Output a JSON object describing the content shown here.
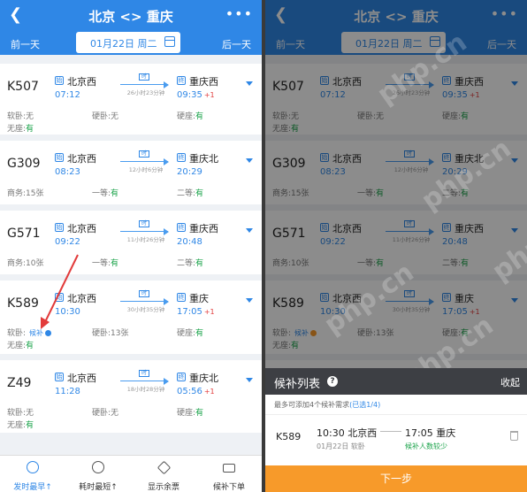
{
  "screen_left": {
    "header": {
      "back_icon": "back-arrow-icon",
      "title": "北京 <> 重庆",
      "more_icon": "more-dots-icon"
    },
    "date_bar": {
      "prev_label": "前一天",
      "date": "01月22日 周二",
      "next_label": "后一天"
    },
    "trains": [
      {
        "number": "K507",
        "from": "北京西",
        "from_tag": "始",
        "dep": "07:12",
        "duration": "26小时23分钟",
        "duration_tag": "时",
        "to": "重庆西",
        "to_tag": "终",
        "arr": "09:35",
        "day_plus": "+1",
        "row1": [
          {
            "label": "软卧:",
            "value": "无",
            "avail": false
          },
          {
            "label": "硬卧:",
            "value": "无",
            "avail": false
          },
          {
            "label": "硬座:",
            "value": "有",
            "avail": true
          }
        ],
        "row2": [
          {
            "label": "无座:",
            "value": "有",
            "avail": true
          }
        ]
      },
      {
        "number": "G309",
        "from": "北京西",
        "from_tag": "始",
        "dep": "08:23",
        "duration": "12小时6分钟",
        "duration_tag": "时",
        "to": "重庆北",
        "to_tag": "终",
        "arr": "20:29",
        "day_plus": "",
        "row1": [
          {
            "label": "商务:",
            "value": "15张",
            "avail": false
          },
          {
            "label": "一等:",
            "value": "有",
            "avail": true
          },
          {
            "label": "二等:",
            "value": "有",
            "avail": true
          }
        ],
        "row2": []
      },
      {
        "number": "G571",
        "from": "北京西",
        "from_tag": "始",
        "dep": "09:22",
        "duration": "11小时26分钟",
        "duration_tag": "时",
        "to": "重庆西",
        "to_tag": "终",
        "arr": "20:48",
        "day_plus": "",
        "row1": [
          {
            "label": "商务:",
            "value": "10张",
            "avail": false
          },
          {
            "label": "一等:",
            "value": "有",
            "avail": true
          },
          {
            "label": "二等:",
            "value": "有",
            "avail": true
          }
        ],
        "row2": []
      },
      {
        "number": "K589",
        "from": "北京西",
        "from_tag": "始",
        "dep": "10:30",
        "duration": "30小时35分钟",
        "duration_tag": "时",
        "to": "重庆",
        "to_tag": "终",
        "arr": "17:05",
        "day_plus": "+1",
        "row1": [
          {
            "label": "软卧:",
            "value": "",
            "avail": false,
            "houbu": "候补"
          },
          {
            "label": "硬卧:",
            "value": "13张",
            "avail": false
          },
          {
            "label": "硬座:",
            "value": "有",
            "avail": true
          }
        ],
        "row2": [
          {
            "label": "无座:",
            "value": "有",
            "avail": true
          }
        ]
      },
      {
        "number": "Z49",
        "from": "北京西",
        "from_tag": "始",
        "dep": "11:28",
        "duration": "18小时28分钟",
        "duration_tag": "时",
        "to": "重庆北",
        "to_tag": "终",
        "arr": "05:56",
        "day_plus": "+1",
        "row1": [
          {
            "label": "软卧:",
            "value": "无",
            "avail": false
          },
          {
            "label": "硬卧:",
            "value": "无",
            "avail": false
          },
          {
            "label": "硬座:",
            "value": "有",
            "avail": true
          }
        ],
        "row2": [
          {
            "label": "无座:",
            "value": "有",
            "avail": true
          }
        ]
      }
    ],
    "tabs": [
      {
        "label": "发时最早↑",
        "icon": "clock-24-icon",
        "active": true
      },
      {
        "label": "耗时最短↑",
        "icon": "timer-icon",
        "active": false
      },
      {
        "label": "显示余票",
        "icon": "ticket-tag-icon",
        "active": false
      },
      {
        "label": "候补下单",
        "icon": "cart-icon",
        "active": false
      }
    ]
  },
  "screen_right": {
    "header": {
      "title": "北京 <> 重庆"
    },
    "date_bar": {
      "prev_label": "前一天",
      "date": "01月22日 周二",
      "next_label": "后一天"
    },
    "sheet": {
      "title": "候补列表",
      "collapse_label": "收起",
      "note": "最多可添加4个候补需求",
      "note_selected": "(已选1/4)",
      "item": {
        "number": "K589",
        "dep": "10:30",
        "from": "北京西",
        "arr": "17:05",
        "to": "重庆",
        "date": "01月22日",
        "seat": "软卧",
        "success_rate": "候补人数较少"
      },
      "next_label": "下一步"
    }
  },
  "watermark_text": "php.cn",
  "colors": {
    "primary": "#2f87e6",
    "available": "#1aa34a",
    "day_plus": "#e23b3b",
    "cta": "#f79a2a",
    "sheet_header": "#3d3f44",
    "annotation": "#e23b3b"
  }
}
